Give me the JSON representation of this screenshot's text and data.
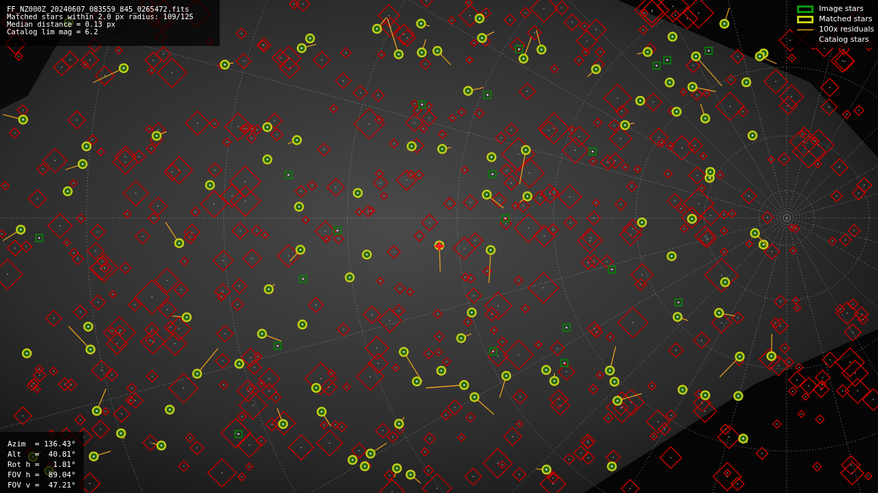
{
  "header": {
    "lines": [
      "FF_NZ000Z_20240607_083559_845_0265472.fits",
      "Matched stars within 2.0 px radius: 109/125",
      "Median distance = 0.13 px",
      "Catalog lim mag = 6.2"
    ]
  },
  "legend": [
    {
      "kind": "image",
      "label": "Image stars"
    },
    {
      "kind": "matched",
      "label": "Matched stars"
    },
    {
      "kind": "residual",
      "label": "100x residuals"
    },
    {
      "kind": "catalog",
      "label": "Catalog stars"
    }
  ],
  "pointing": {
    "lines": [
      "Azim  = 136.43°",
      "Alt   =  40.81°",
      "Rot h =   1.81°",
      "FOV h =  89.04°",
      "FOV v =  47.21°"
    ]
  }
}
